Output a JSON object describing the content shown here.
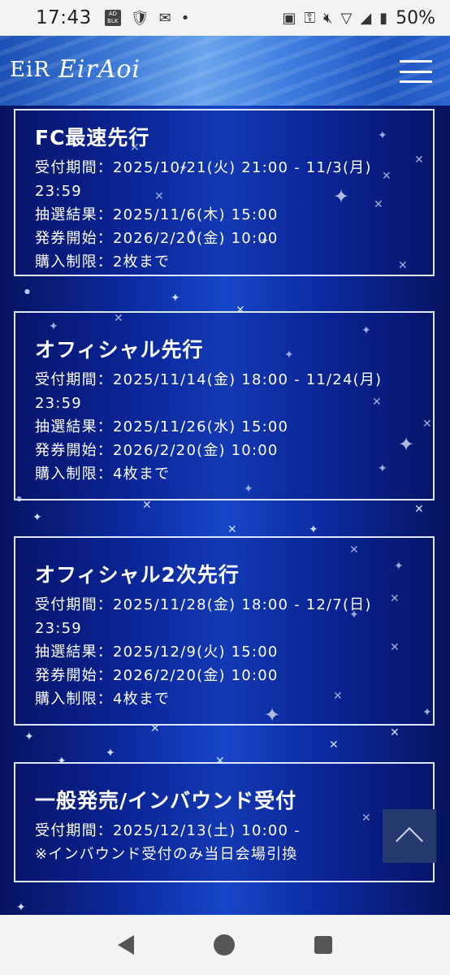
{
  "status_bar": {
    "time": "17:43",
    "battery": "50%"
  },
  "header": {
    "logo_mark": "EiR",
    "logo_text": "EirAoi"
  },
  "cards": [
    {
      "title": "FC最速先行",
      "lines": [
        "受付期間：2025/10/21(火) 21:00 - 11/3(月)",
        "23:59",
        "抽選結果：2025/11/6(木) 15:00",
        "発券開始：2026/2/20(金) 10:00",
        "購入制限：2枚まで"
      ]
    },
    {
      "title": "オフィシャル先行",
      "lines": [
        "受付期間：2025/11/14(金) 18:00 - 11/24(月)",
        "23:59",
        "抽選結果：2025/11/26(水) 15:00",
        "発券開始：2026/2/20(金) 10:00",
        "購入制限：4枚まで"
      ]
    },
    {
      "title": "オフィシャル2次先行",
      "lines": [
        "受付期間：2025/11/28(金) 18:00 - 12/7(日)",
        "23:59",
        "抽選結果：2025/12/9(火) 15:00",
        "発券開始：2026/2/20(金) 10:00",
        "購入制限：4枚まで"
      ]
    },
    {
      "title": "一般発売/インバウンド受付",
      "lines": [
        "受付期間：2025/12/13(土) 10:00 -",
        "※インバウンド受付のみ当日会場引換"
      ]
    }
  ]
}
